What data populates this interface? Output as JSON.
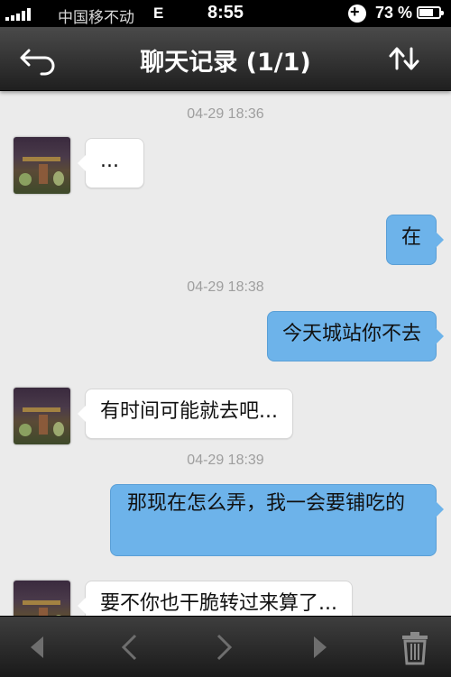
{
  "status_bar": {
    "carrier": "中国移不动",
    "network": "E",
    "time": "8:55",
    "battery_percent_label": "73 %",
    "battery_level": 0.73
  },
  "nav": {
    "title": "聊天记录 (1/1)",
    "back_icon": "back-arrow-icon",
    "sort_icon": "sort-arrows-icon"
  },
  "messages": [
    {
      "type": "timestamp",
      "text": "04-29 18:36"
    },
    {
      "type": "incoming",
      "text": "..."
    },
    {
      "type": "outgoing",
      "text": "在"
    },
    {
      "type": "timestamp",
      "text": "04-29 18:38"
    },
    {
      "type": "outgoing",
      "text": "今天城站你不去"
    },
    {
      "type": "incoming",
      "text": "有时间可能就去吧..."
    },
    {
      "type": "timestamp",
      "text": "04-29 18:39"
    },
    {
      "type": "outgoing",
      "text": "那现在怎么弄，我一会要铺吃的"
    },
    {
      "type": "incoming",
      "text": "要不你也干脆转过来算了..."
    }
  ],
  "toolbar": {
    "icons": [
      "first-page-icon",
      "previous-page-icon",
      "next-page-icon",
      "last-page-icon",
      "trash-icon"
    ]
  },
  "colors": {
    "outgoing_bubble": "#6db3ea",
    "incoming_bubble": "#ffffff",
    "background": "#ebebeb",
    "timestamp": "#9e9e9e"
  }
}
